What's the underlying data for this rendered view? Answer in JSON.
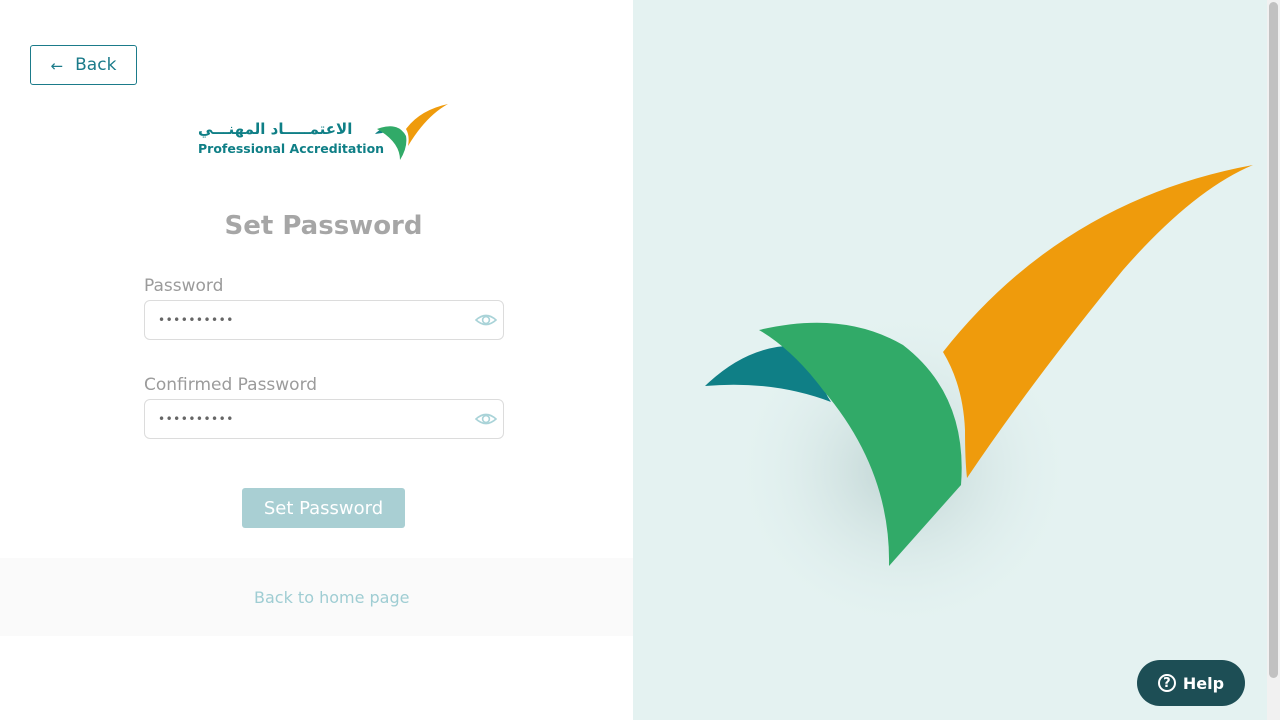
{
  "nav": {
    "back_label": "Back",
    "back_icon": "arrow-left-icon"
  },
  "logo": {
    "arabic": "الاعتمـــــاد المهنـــي",
    "english": "Professional Accreditation"
  },
  "form": {
    "title": "Set Password",
    "password_label": "Password",
    "password_value": "••••••••••",
    "confirm_label": "Confirmed Password",
    "confirm_value": "••••••••••",
    "submit_label": "Set Password"
  },
  "footer": {
    "home_link": "Back to home page"
  },
  "help": {
    "label": "Help",
    "icon_text": "?"
  },
  "colors": {
    "teal": "#1b7b8a",
    "green": "#31aa68",
    "orange": "#ef9b0c",
    "panel": "#e4f2f1",
    "help_bg": "#1d4e55"
  }
}
